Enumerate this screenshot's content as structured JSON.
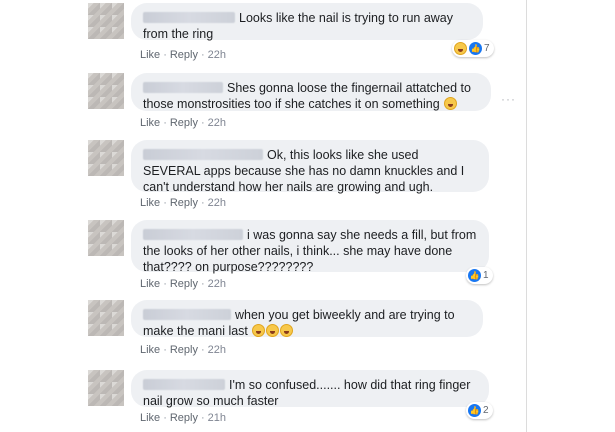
{
  "actions": {
    "like": "Like",
    "reply": "Reply",
    "sep": "·"
  },
  "more_label": "···",
  "comments": [
    {
      "text": "Looks like the nail is trying to run away from the ring",
      "time": "22h",
      "reactions": {
        "count": "7",
        "types": [
          "haha",
          "like"
        ]
      }
    },
    {
      "text": "Shes gonna loose the fingernail attatched to those monstrosities too if she catches it on something",
      "time": "22h"
    },
    {
      "text": "Ok, this looks like she used SEVERAL apps because she has no damn knuckles and I can't understand how her nails are growing and ugh.",
      "time": "22h"
    },
    {
      "text": "i was gonna say she needs a fill, but from the looks of her other nails, i think... she may have done that???? on purpose????????",
      "time": "22h",
      "reactions": {
        "count": "1",
        "types": [
          "like"
        ]
      }
    },
    {
      "text": "when you get biweekly and are trying to make the mani last",
      "time": "22h"
    },
    {
      "text": "I'm so confused....... how did that ring finger nail grow so much faster",
      "time": "21h",
      "reactions": {
        "count": "2",
        "types": [
          "like"
        ]
      }
    }
  ]
}
